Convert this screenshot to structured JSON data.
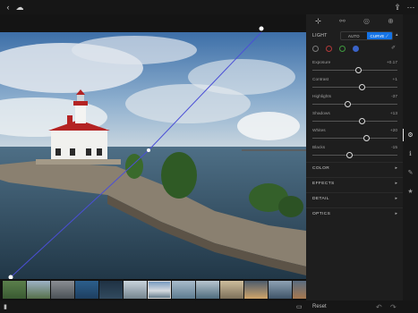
{
  "topbar": {
    "back_icon": "‹",
    "cloud_icon": "☁",
    "share_icon": "⇪",
    "more_icon": "···"
  },
  "panel_tabs": [
    {
      "icon": "⊹",
      "name": "edit-tab"
    },
    {
      "icon": "⚯",
      "name": "presets-tab"
    },
    {
      "icon": "◎",
      "name": "selective-tab"
    },
    {
      "icon": "⊕",
      "name": "healing-tab"
    }
  ],
  "light": {
    "label": "LIGHT",
    "auto": "AUTO",
    "curve": "CURVE ⟋",
    "caret": "▴"
  },
  "sliders": [
    {
      "name": "Exposure",
      "value": "+0.17",
      "level": 0.54
    },
    {
      "name": "Contrast",
      "value": "+1",
      "level": 0.58
    },
    {
      "name": "Highlights",
      "value": "-37",
      "level": 0.42
    },
    {
      "name": "Shadows",
      "value": "+13",
      "level": 0.58
    },
    {
      "name": "Whites",
      "value": "+20",
      "level": 0.64
    },
    {
      "name": "Blacks",
      "value": "-15",
      "level": 0.44
    }
  ],
  "sections": [
    {
      "label": "COLOR",
      "caret": "▸"
    },
    {
      "label": "EFFECTS",
      "caret": "▸"
    },
    {
      "label": "DETAIL",
      "caret": "▸"
    },
    {
      "label": "OPTICS",
      "caret": "▸"
    }
  ],
  "rail": [
    {
      "icon": "⚙",
      "name": "adjust-rail-icon"
    },
    {
      "icon": "ℹ",
      "name": "info-rail-icon"
    },
    {
      "icon": "✎",
      "name": "comment-rail-icon"
    },
    {
      "icon": "★",
      "name": "rating-rail-icon"
    }
  ],
  "bottombar": {
    "panel_toggle": "▮",
    "filmstrip_toggle": "▭",
    "reset": "Reset",
    "undo": "↶",
    "redo": "↷"
  },
  "colors": {
    "accent": "#1473e6",
    "panel_bg": "#1e1e1e"
  }
}
